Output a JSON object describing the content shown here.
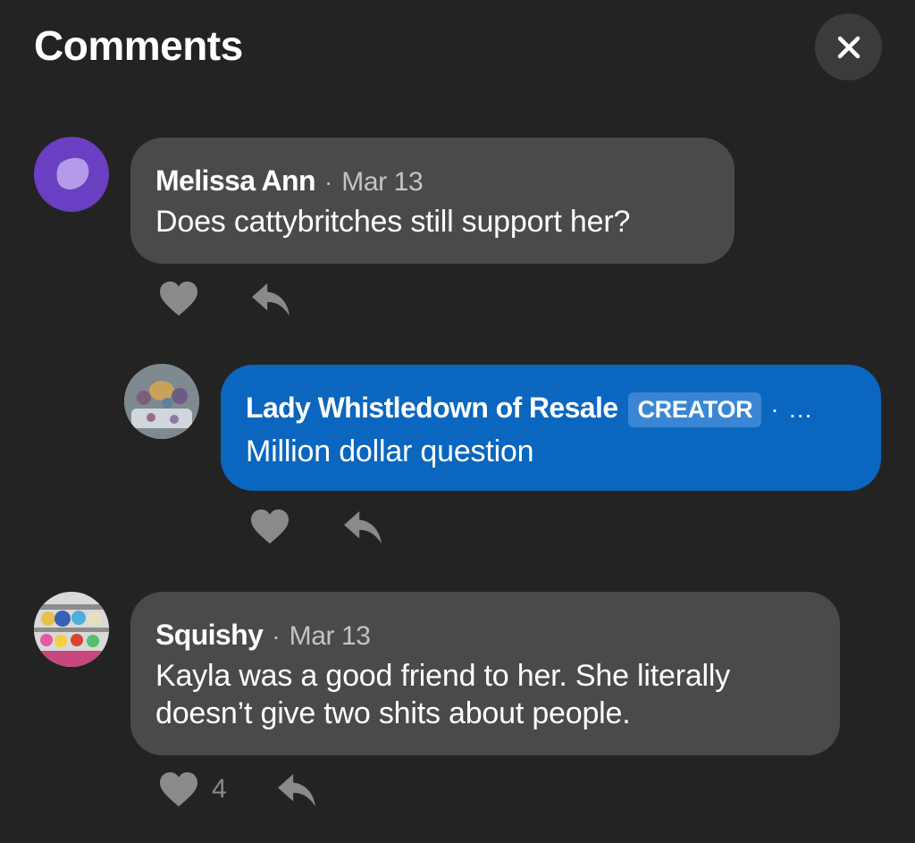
{
  "header": {
    "title": "Comments",
    "close_icon": "close-icon"
  },
  "comments": [
    {
      "author": "Melissa Ann",
      "date": "Mar 13",
      "text": "Does cattybritches still support her?",
      "avatar_color": "#6a3fc2"
    },
    {
      "author": "Lady Whistledown of Resale",
      "badge": "CREATOR",
      "more": "…",
      "text": "Million dollar question",
      "is_reply": true
    },
    {
      "author": "Squishy",
      "date": "Mar 13",
      "text": "Kayla was a good friend to her. She literally doesn’t give two shits about people.",
      "likes": "4"
    }
  ],
  "colors": {
    "background": "#232323",
    "bubble": "#4a4a4a",
    "creator_bubble": "#0b66bf",
    "icon": "#8a8a8a"
  },
  "icons": [
    "heart-icon",
    "reply-icon",
    "close-icon"
  ]
}
